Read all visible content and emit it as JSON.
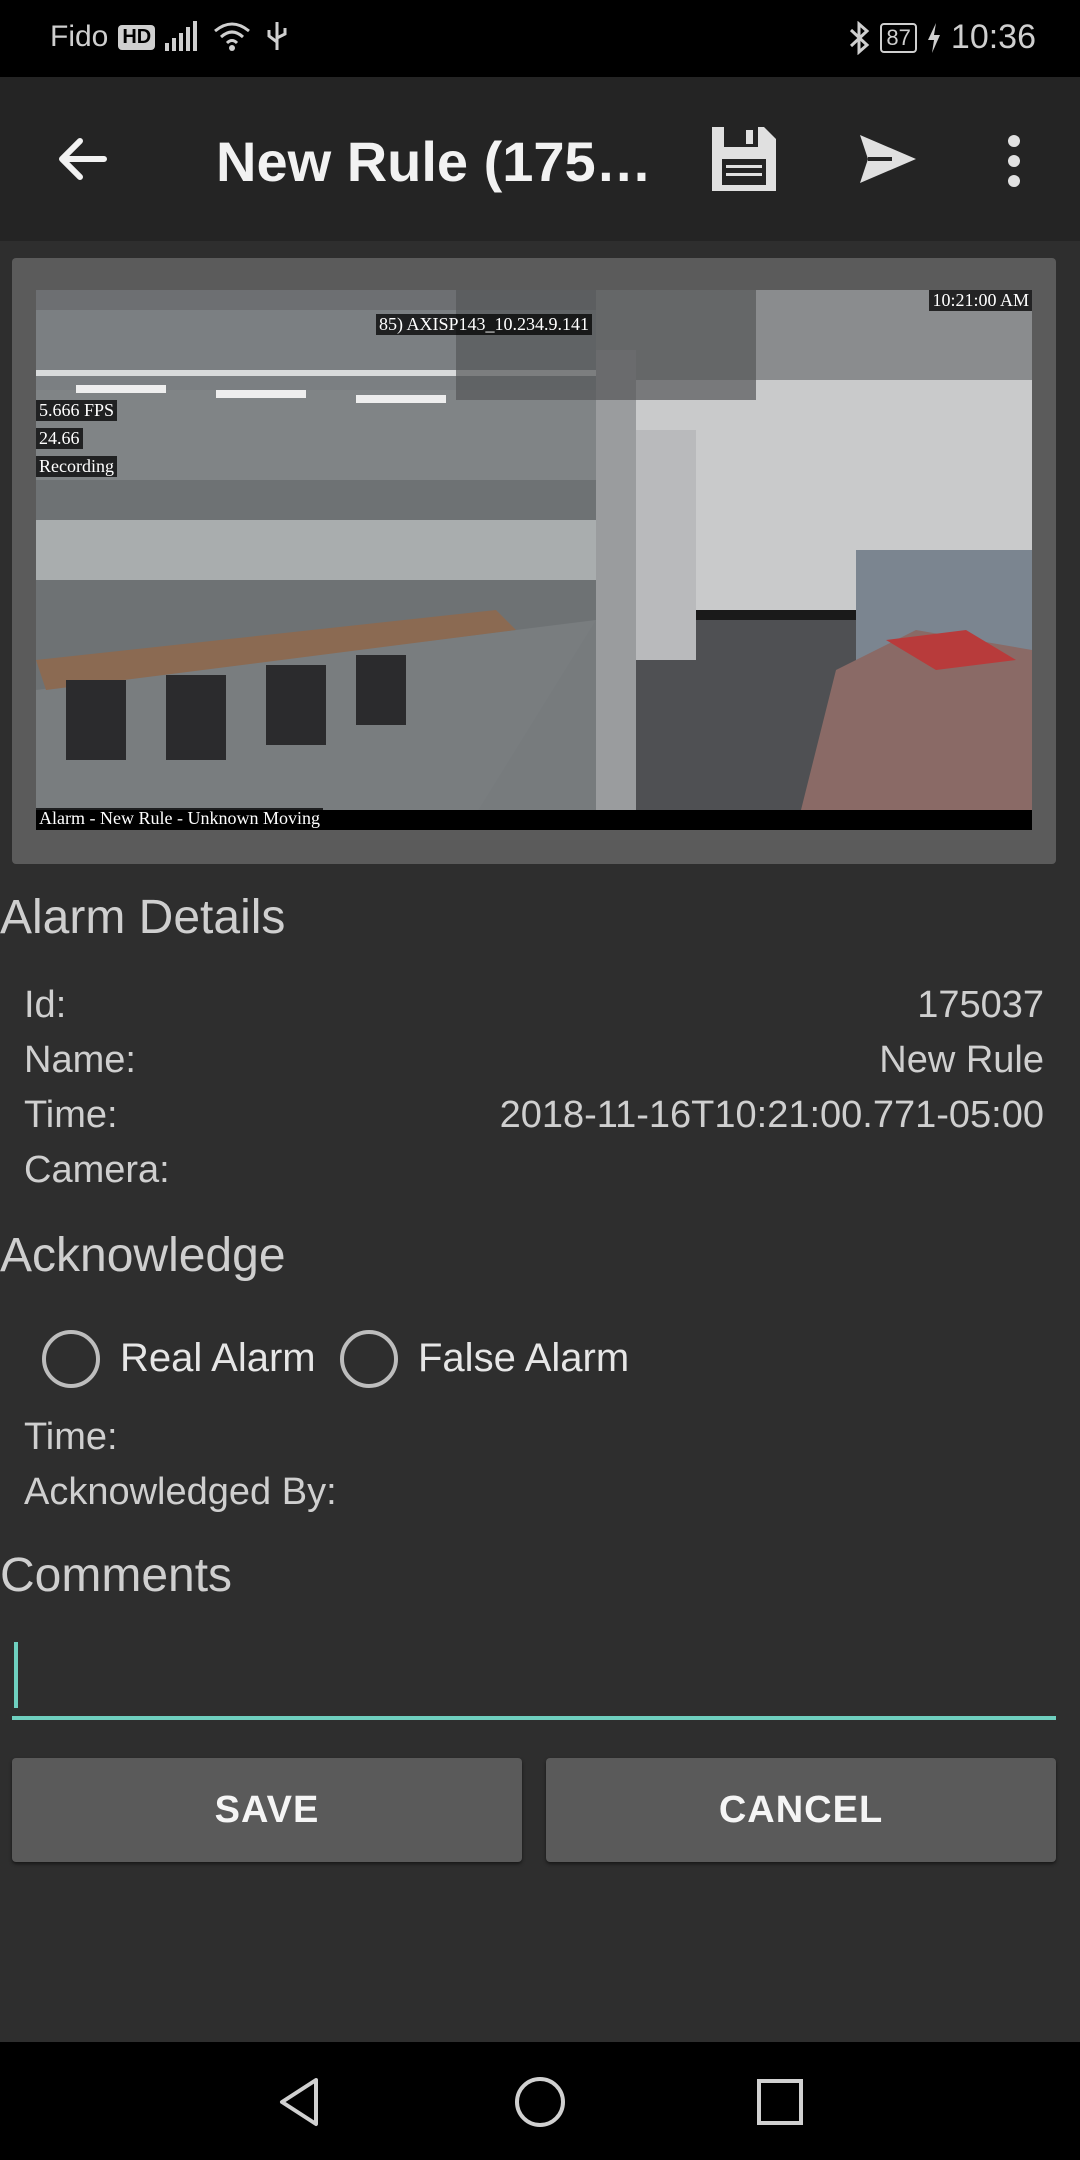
{
  "status_bar": {
    "carrier": "Fido",
    "hd": "HD",
    "battery": "87",
    "time": "10:36"
  },
  "app_bar": {
    "title": "New Rule (175037)",
    "icons": [
      "back-arrow-icon",
      "save-icon",
      "send-icon",
      "more-vert-icon"
    ]
  },
  "camera": {
    "camera_label": "85) AXISP143_10.234.9.141",
    "timestamp": "10:21:00 AM",
    "fps": "5.666 FPS",
    "bitrate": "24.66",
    "recording": "Recording",
    "caption": "Alarm - New Rule - Unknown Moving"
  },
  "alarm_details": {
    "title": "Alarm Details",
    "id_label": "Id:",
    "id_value": "175037",
    "name_label": "Name:",
    "name_value": "New Rule",
    "time_label": "Time:",
    "time_value": "2018-11-16T10:21:00.771-05:00",
    "camera_label": "Camera:",
    "camera_value": ""
  },
  "acknowledge": {
    "title": "Acknowledge",
    "options": [
      "Real Alarm",
      "False Alarm"
    ],
    "time_label": "Time:",
    "ack_by_label": "Acknowledged By:"
  },
  "comments": {
    "title": "Comments",
    "value": ""
  },
  "buttons": {
    "save": "SAVE",
    "cancel": "CANCEL"
  },
  "colors": {
    "accent": "#6fcfbf",
    "background": "#2e2e2e",
    "app_bar": "#242424",
    "button": "#5a5a5a"
  }
}
